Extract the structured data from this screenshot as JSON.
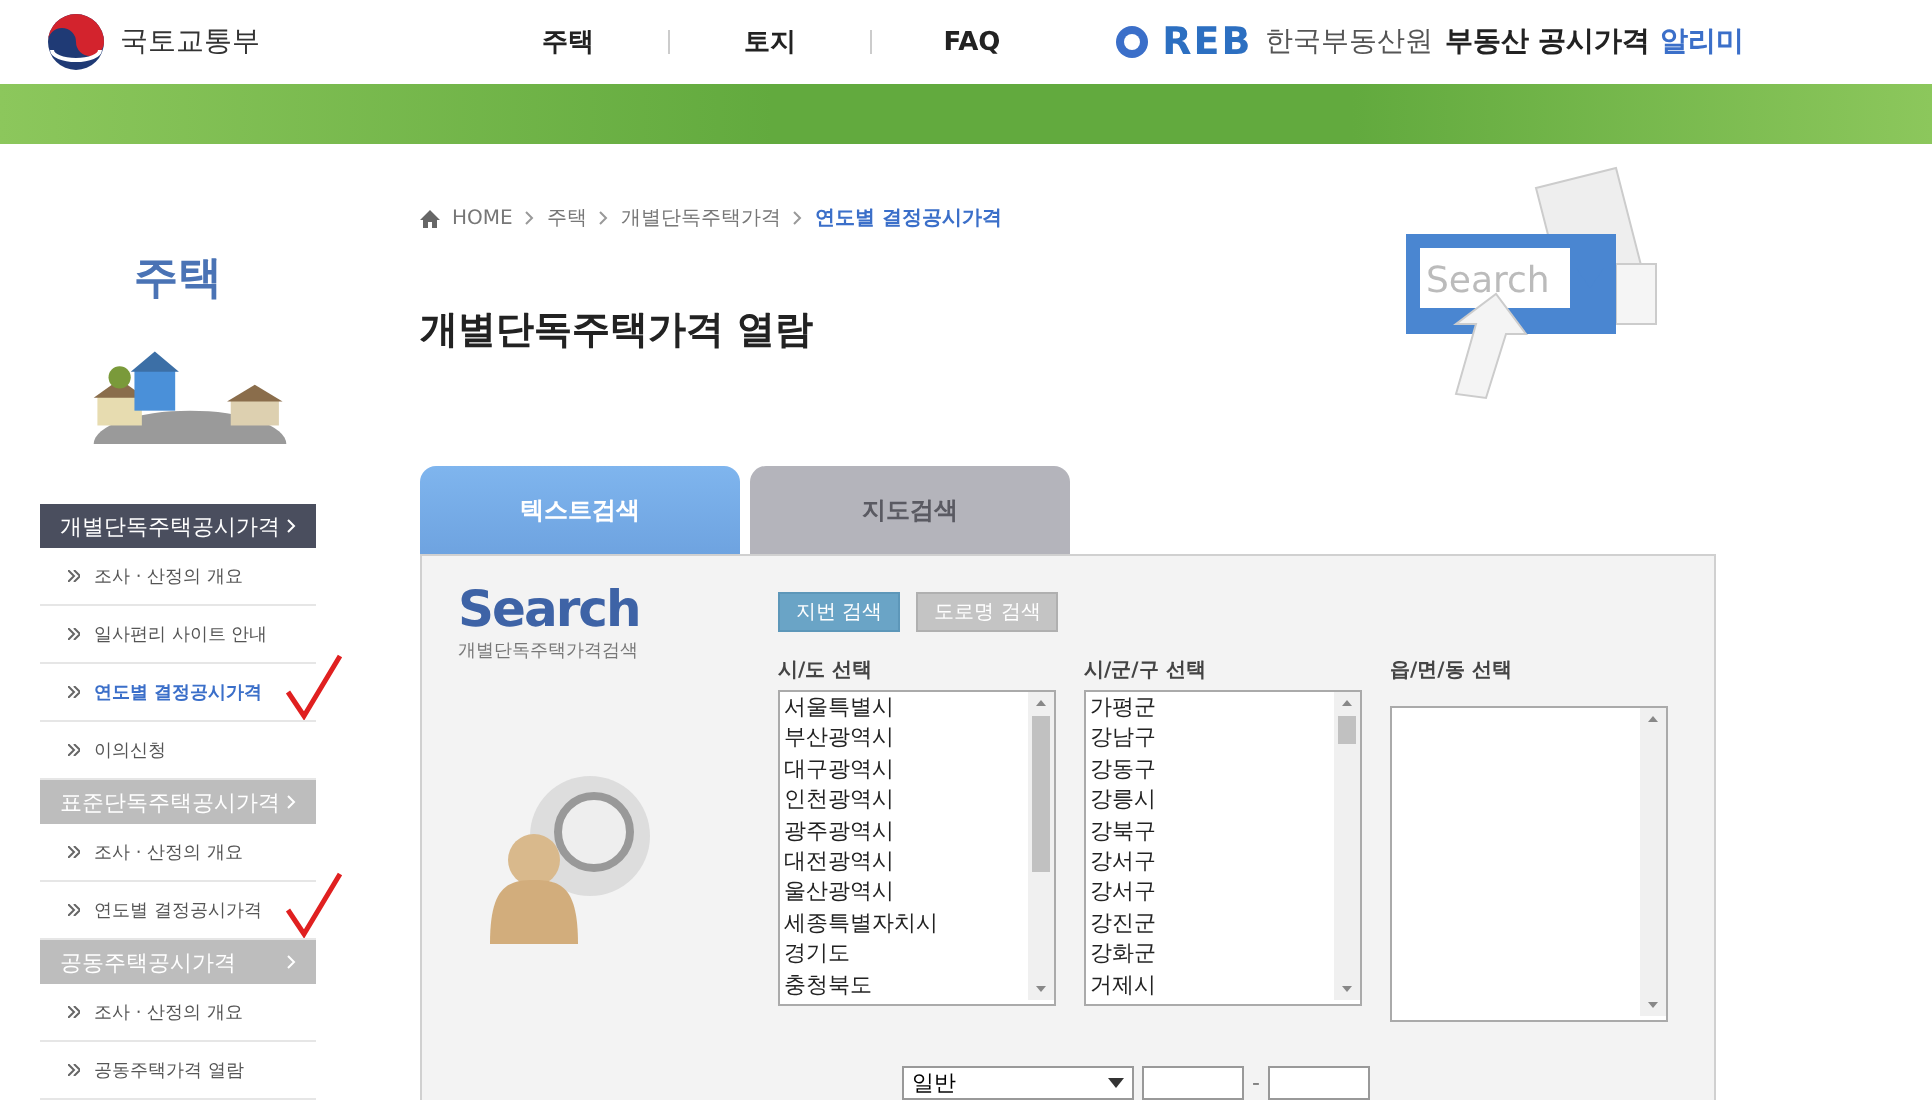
{
  "header": {
    "ministry": "국토교통부",
    "nav": [
      {
        "label": "주택"
      },
      {
        "label": "토지"
      },
      {
        "label": "FAQ"
      }
    ],
    "brand": {
      "mark": "REB",
      "org": "한국부동산원",
      "service": "부동산 공시가격",
      "highlight": "알리미"
    }
  },
  "sidebar": {
    "title": "주택",
    "sections": [
      {
        "label": "개별단독주택공시가격",
        "active": true,
        "items": [
          {
            "label": "조사 · 산정의 개요",
            "selected": false,
            "marked": false
          },
          {
            "label": "일사편리 사이트 안내",
            "selected": false,
            "marked": false
          },
          {
            "label": "연도별 결정공시가격",
            "selected": true,
            "marked": true
          },
          {
            "label": "이의신청",
            "selected": false,
            "marked": false
          }
        ]
      },
      {
        "label": "표준단독주택공시가격",
        "active": false,
        "items": [
          {
            "label": "조사 · 산정의 개요",
            "selected": false,
            "marked": false
          },
          {
            "label": "연도별 결정공시가격",
            "selected": false,
            "marked": true
          }
        ]
      },
      {
        "label": "공동주택공시가격",
        "active": false,
        "items": [
          {
            "label": "조사 · 산정의 개요",
            "selected": false,
            "marked": false
          },
          {
            "label": "공동주택가격 열람",
            "selected": false,
            "marked": false
          }
        ]
      }
    ]
  },
  "breadcrumb": {
    "home": "HOME",
    "items": [
      {
        "label": "주택",
        "current": false
      },
      {
        "label": "개별단독주택가격",
        "current": false
      },
      {
        "label": "연도별 결정공시가격",
        "current": true
      }
    ]
  },
  "illustration": {
    "label": "Search"
  },
  "page_title": "개별단독주택가격 열람",
  "tabs": [
    {
      "label": "텍스트검색",
      "selected": true
    },
    {
      "label": "지도검색",
      "selected": false
    }
  ],
  "search": {
    "logo_title": "Search",
    "logo_subtitle": "개별단독주택가격검색",
    "modes": [
      {
        "label": "지번 검색",
        "selected": true
      },
      {
        "label": "도로명 검색",
        "selected": false
      }
    ],
    "lists": [
      {
        "label": "시/도 선택",
        "options": [
          "서울특별시",
          "부산광역시",
          "대구광역시",
          "인천광역시",
          "광주광역시",
          "대전광역시",
          "울산광역시",
          "세종특별자치시",
          "경기도",
          "충청북도"
        ]
      },
      {
        "label": "시/군/구 선택",
        "options": [
          "가평군",
          "강남구",
          "강동구",
          "강릉시",
          "강북구",
          "강서구",
          "강서구",
          "강진군",
          "강화군",
          "거제시"
        ]
      },
      {
        "label": "읍/면/동 선택"
      }
    ],
    "type_select": "일반",
    "dash": "-"
  }
}
